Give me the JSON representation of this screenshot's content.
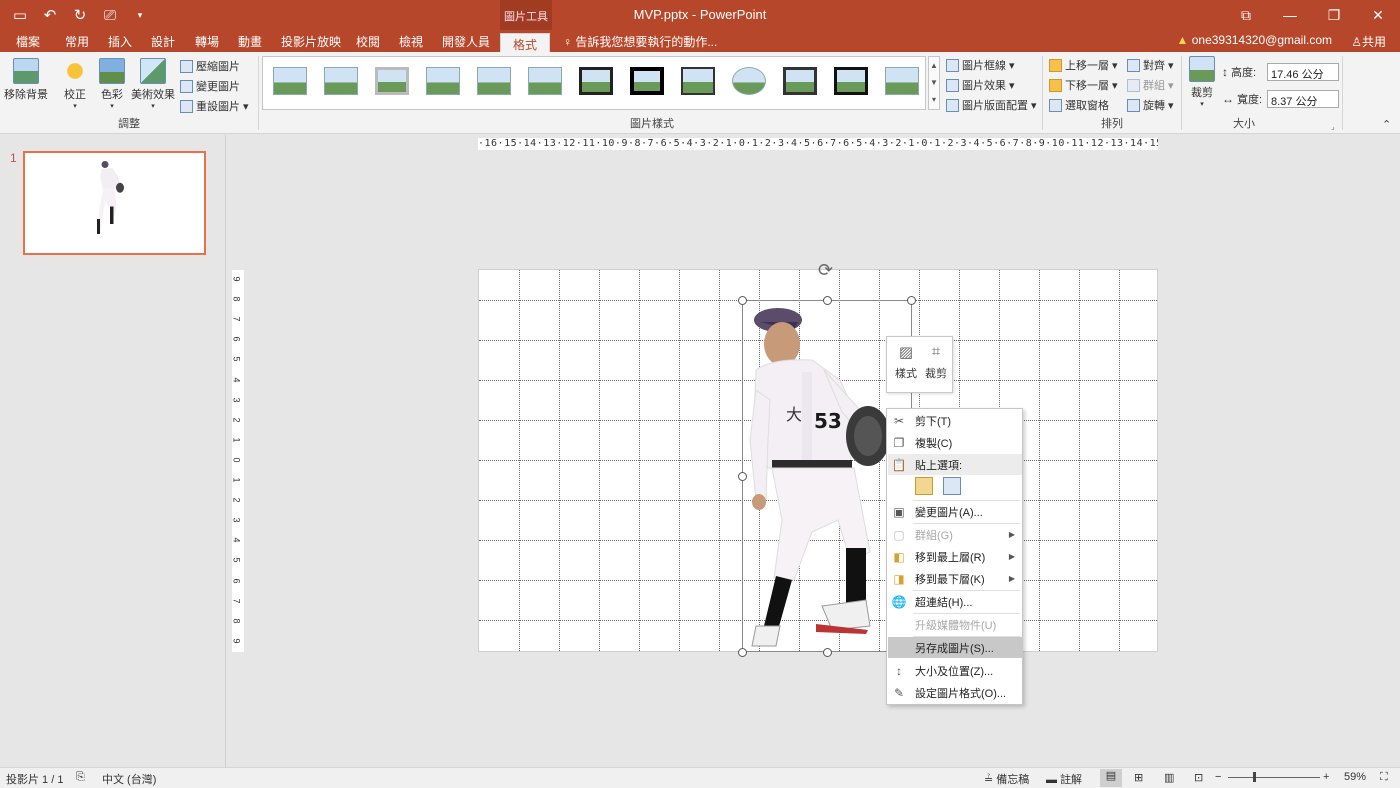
{
  "window": {
    "title": "MVP.pptx - PowerPoint",
    "context_tab_group": "圖片工具"
  },
  "quick_access": [
    {
      "icon": "save-icon"
    },
    {
      "icon": "undo-icon"
    },
    {
      "icon": "redo-icon"
    },
    {
      "icon": "start-from-beginning-icon"
    },
    {
      "icon": "customize-qat-icon"
    }
  ],
  "tabs": [
    "檔案",
    "常用",
    "插入",
    "設計",
    "轉場",
    "動畫",
    "投影片放映",
    "校閱",
    "檢視",
    "開發人員",
    "格式"
  ],
  "active_tab": "格式",
  "tell_me": "告訴我您想要執行的動作...",
  "account": "one39314320@gmail.com",
  "share": "共用",
  "ribbon": {
    "adjust": {
      "remove_bg": "移除背景",
      "corrections": "校正",
      "color": "色彩",
      "artistic": "美術效果",
      "compress": "壓縮圖片",
      "change": "變更圖片",
      "reset": "重設圖片",
      "label": "調整"
    },
    "styles": {
      "border": "圖片框線",
      "effects": "圖片效果",
      "layout": "圖片版面配置",
      "label": "圖片樣式"
    },
    "arrange": {
      "forward": "上移一層",
      "backward": "下移一層",
      "selection_pane": "選取窗格",
      "align": "對齊",
      "group": "群組",
      "rotate": "旋轉",
      "label": "排列"
    },
    "size": {
      "crop": "裁剪",
      "height_label": "高度:",
      "height_value": "17.46 公分",
      "width_label": "寬度:",
      "width_value": "8.37 公分",
      "label": "大小"
    }
  },
  "thumbnail": {
    "number": "1"
  },
  "hruler": "·16·15·14·13·12·11·10·9·8·7·6·5·4·3·2·1·0·1·2·3·4·5·6·7·6·5·4·3·2·1·0·1·2·3·4·5·6·7·8·9·10·11·12·13·14·15·16·",
  "vruler": [
    "9",
    "8",
    "7",
    "6",
    "5",
    "4",
    "3",
    "2",
    "1",
    "0",
    "1",
    "2",
    "3",
    "4",
    "5",
    "6",
    "7",
    "8",
    "9"
  ],
  "minibar": {
    "style": "樣式",
    "crop": "裁剪"
  },
  "context_menu": {
    "cut": "剪下(T)",
    "copy": "複製(C)",
    "paste_options": "貼上選項:",
    "change_picture": "變更圖片(A)...",
    "group": "群組(G)",
    "bring_front": "移到最上層(R)",
    "send_back": "移到最下層(K)",
    "hyperlink": "超連結(H)...",
    "upgrade_media": "升級媒體物件(U)",
    "save_as_picture": "另存成圖片(S)...",
    "size_position": "大小及位置(Z)...",
    "format_picture": "設定圖片格式(O)..."
  },
  "status": {
    "slide": "投影片 1 / 1",
    "language": "中文 (台灣)",
    "notes": "備忘稿",
    "comments": "註解",
    "zoom": "59%"
  },
  "colors": {
    "accent": "#b7472a",
    "selection": "#e8704a"
  }
}
